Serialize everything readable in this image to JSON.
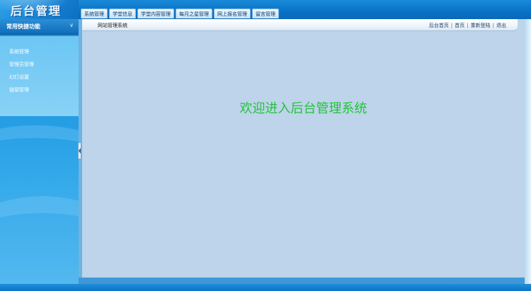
{
  "logo": {
    "text": "后台管理"
  },
  "topnav": {
    "tabs": [
      {
        "label": "系统管理"
      },
      {
        "label": "学堂信息"
      },
      {
        "label": "学堂内容管理"
      },
      {
        "label": "每月之星管理"
      },
      {
        "label": "网上报名管理"
      },
      {
        "label": "留言管理"
      }
    ]
  },
  "sidebar": {
    "title": "常用快捷功能",
    "items": [
      {
        "label": "系统管理"
      },
      {
        "label": "管理员管理"
      },
      {
        "label": "幻灯设置"
      },
      {
        "label": "链接管理"
      }
    ]
  },
  "header": {
    "site_title": "网站管理系统",
    "links": {
      "admin_home": "后台首页",
      "home": "首页",
      "relogin": "重新登陆",
      "logout": "退出"
    }
  },
  "main": {
    "welcome": "欢迎进入后台管理系统"
  }
}
